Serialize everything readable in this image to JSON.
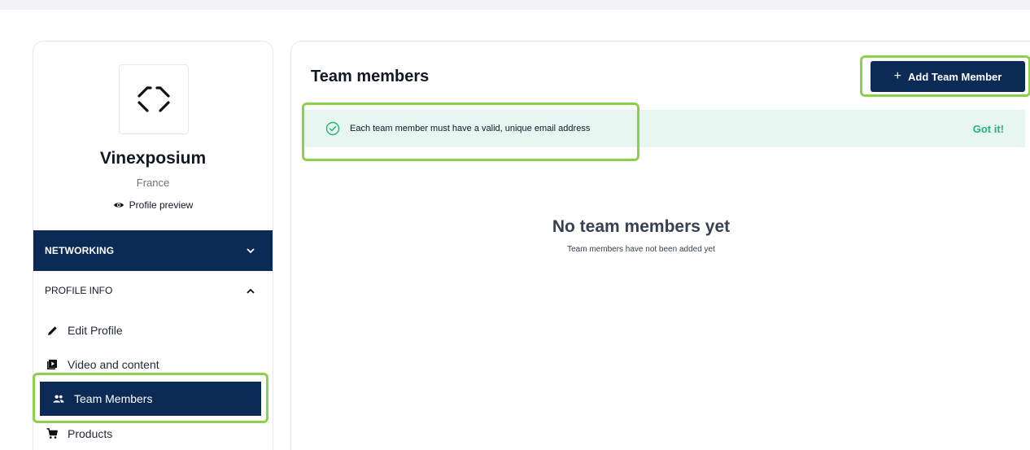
{
  "sidebar": {
    "org_name": "Vinexposium",
    "country": "France",
    "profile_preview": "Profile preview",
    "sections": {
      "networking": "NETWORKING",
      "profile_info": "PROFILE INFO"
    },
    "items": [
      {
        "label": "Edit Profile",
        "icon": "pencil-icon"
      },
      {
        "label": "Video and content",
        "icon": "video-icon"
      },
      {
        "label": "Team Members",
        "icon": "team-icon",
        "active": true
      },
      {
        "label": "Products",
        "icon": "cart-icon"
      }
    ]
  },
  "main": {
    "title": "Team members",
    "add_button": "Add Team Member",
    "add_button_icon": "+",
    "notice": {
      "text": "Each team member must have a valid, unique email address",
      "action": "Got it!"
    },
    "empty": {
      "title": "No team members yet",
      "subtitle": "Team members have not been added yet"
    }
  },
  "colors": {
    "navy": "#0b2a56",
    "highlight": "#8bd24a",
    "notice_bg": "#e7f6f1",
    "success": "#22b573"
  }
}
